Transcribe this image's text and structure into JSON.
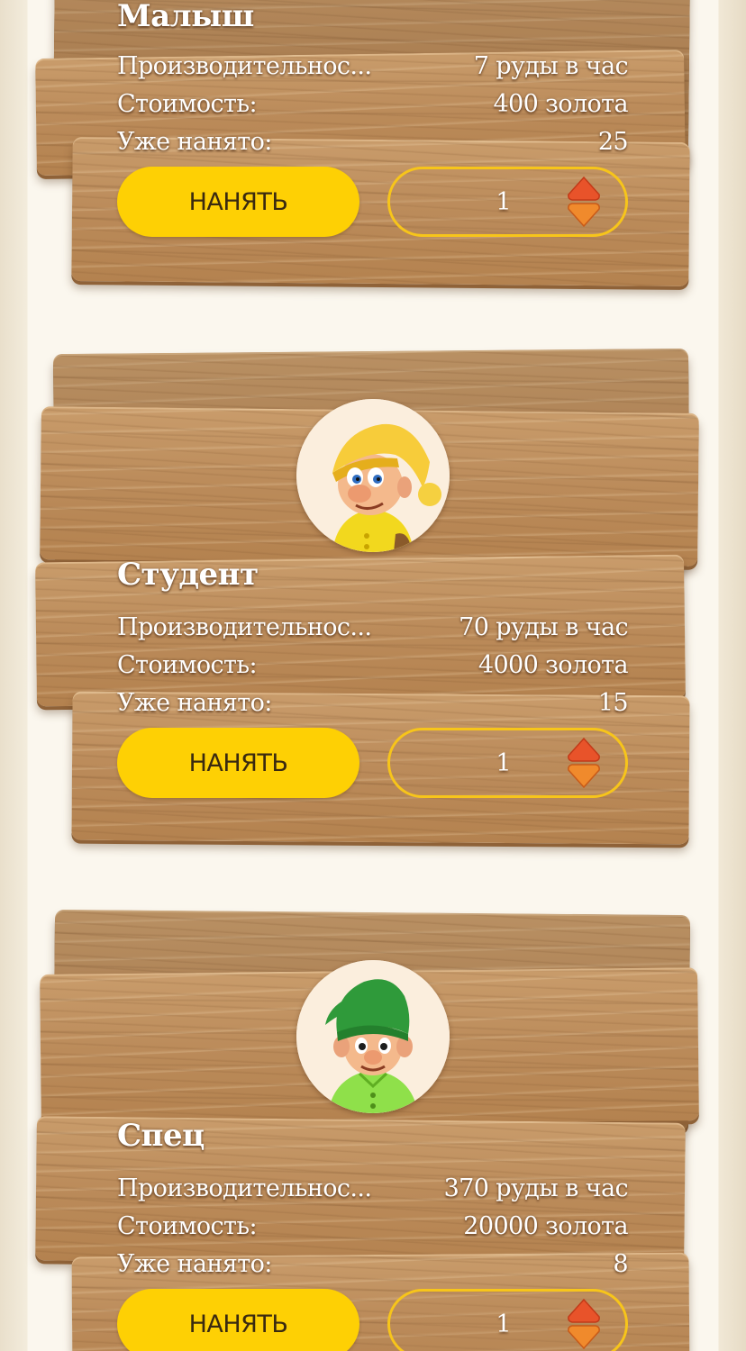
{
  "cards": [
    {
      "title": "Малыш",
      "productivity_label": "Производительнос...",
      "productivity_value": "7 руды в час",
      "cost_label": "Стоимость:",
      "cost_value": "400 золота",
      "hired_label": "Уже нанято:",
      "hired_value": "25",
      "hire_button": "НАНЯТЬ",
      "quantity": "1"
    },
    {
      "title": "Студент",
      "avatar": "gnome-yellow-cap",
      "productivity_label": "Производительнос...",
      "productivity_value": "70 руды в час",
      "cost_label": "Стоимость:",
      "cost_value": "4000 золота",
      "hired_label": "Уже нанято:",
      "hired_value": "15",
      "hire_button": "НАНЯТЬ",
      "quantity": "1"
    },
    {
      "title": "Спец",
      "avatar": "gnome-green-cap",
      "productivity_label": "Производительнос...",
      "productivity_value": "370 руды в час",
      "cost_label": "Стоимость:",
      "cost_value": "20000 золота",
      "hired_label": "Уже нанято:",
      "hired_value": "8",
      "hire_button": "НАНЯТЬ",
      "quantity": "1"
    }
  ],
  "colors": {
    "button": "#fed004",
    "stepper_border": "#f7c51a",
    "wood": "#bb8b5a",
    "arrow_top": "#e8532a",
    "arrow_bottom": "#f08a2c"
  }
}
